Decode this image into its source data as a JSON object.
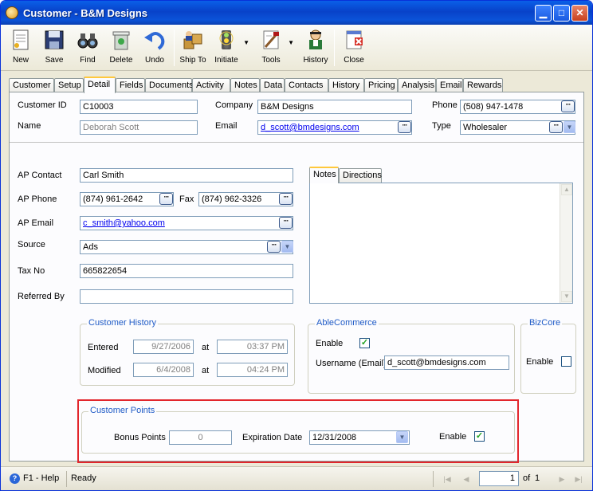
{
  "window": {
    "title": "Customer - B&M Designs"
  },
  "toolbar": {
    "new": "New",
    "save": "Save",
    "find": "Find",
    "delete": "Delete",
    "undo": "Undo",
    "ship_to": "Ship To",
    "initiate": "Initiate",
    "tools": "Tools",
    "history": "History",
    "close": "Close"
  },
  "tabs": [
    "Customer",
    "Setup",
    "Detail",
    "Fields",
    "Documents",
    "Activity",
    "Notes",
    "Data",
    "Contacts",
    "History",
    "Pricing",
    "Analysis",
    "Email",
    "Rewards"
  ],
  "active_tab": "Detail",
  "header": {
    "customer_id_label": "Customer ID",
    "customer_id": "C10003",
    "name_label": "Name",
    "name": "Deborah  Scott",
    "company_label": "Company",
    "company": "B&M Designs",
    "email_label": "Email",
    "email": "d_scott@bmdesigns.com",
    "phone_label": "Phone",
    "phone": "(508) 947-1478",
    "type_label": "Type",
    "type": "Wholesaler"
  },
  "detail": {
    "ap_contact_label": "AP Contact",
    "ap_contact": "Carl Smith",
    "ap_phone_label": "AP Phone",
    "ap_phone": "(874) 961-2642",
    "fax_label": "Fax",
    "fax": "(874) 962-3326",
    "ap_email_label": "AP Email",
    "ap_email": "c_smith@yahoo.com",
    "source_label": "Source",
    "source": "Ads",
    "tax_no_label": "Tax No",
    "tax_no": "665822654",
    "referred_by_label": "Referred By",
    "referred_by": ""
  },
  "notes_tabs": [
    "Notes",
    "Directions"
  ],
  "customer_history": {
    "legend": "Customer History",
    "entered_label": "Entered",
    "entered_date": "9/27/2006",
    "entered_time": "03:37 PM",
    "modified_label": "Modified",
    "modified_date": "6/4/2008",
    "modified_time": "04:24 PM",
    "at_label": "at"
  },
  "able_commerce": {
    "legend": "AbleCommerce",
    "enable_label": "Enable",
    "enable": true,
    "username_label": "Username (Email)",
    "username": "d_scott@bmdesigns.com"
  },
  "bizcore": {
    "legend": "BizCore",
    "enable_label": "Enable",
    "enable": false
  },
  "customer_points": {
    "legend": "Customer Points",
    "bonus_points_label": "Bonus Points",
    "bonus_points": "0",
    "expiration_label": "Expiration Date",
    "expiration_date": "12/31/2008",
    "enable_label": "Enable",
    "enable": true
  },
  "status": {
    "help": "F1 - Help",
    "state": "Ready",
    "page": "1",
    "of_label": "of",
    "total": "1"
  },
  "colors": {
    "highlight_box": "#e2262c",
    "legend_text": "#1f5bc6",
    "title_bar": "#0842c9"
  }
}
